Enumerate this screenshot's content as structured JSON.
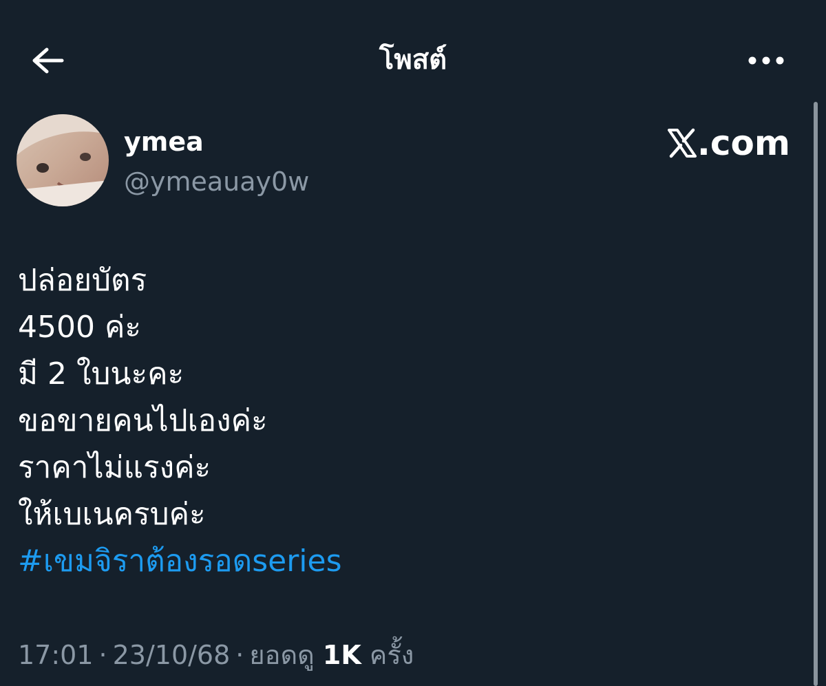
{
  "header": {
    "title": "โพสต์",
    "back_icon": "arrow-left-icon",
    "more_icon": "more-horizontal-icon"
  },
  "author": {
    "display_name": "ymea",
    "handle": "@ymeauay0w"
  },
  "watermark": {
    "text": ".com"
  },
  "post": {
    "lines": [
      "ปล่อยบัตร",
      "4500 ค่ะ",
      "มี 2 ใบนะคะ",
      "ขอขายคนไปเองค่ะ",
      "ราคาไม่แรงค่ะ",
      "ให้เบเนครบค่ะ"
    ],
    "hashtag": "#เขมจิราต้องรอดseries"
  },
  "meta": {
    "time": "17:01",
    "date": "23/10/68",
    "views_label": "ยอดดู",
    "views_count": "1K",
    "views_unit": "ครั้ง"
  },
  "colors": {
    "background": "#15202b",
    "text": "#ffffff",
    "secondary": "#8b98a5",
    "link": "#1d9bf0"
  }
}
